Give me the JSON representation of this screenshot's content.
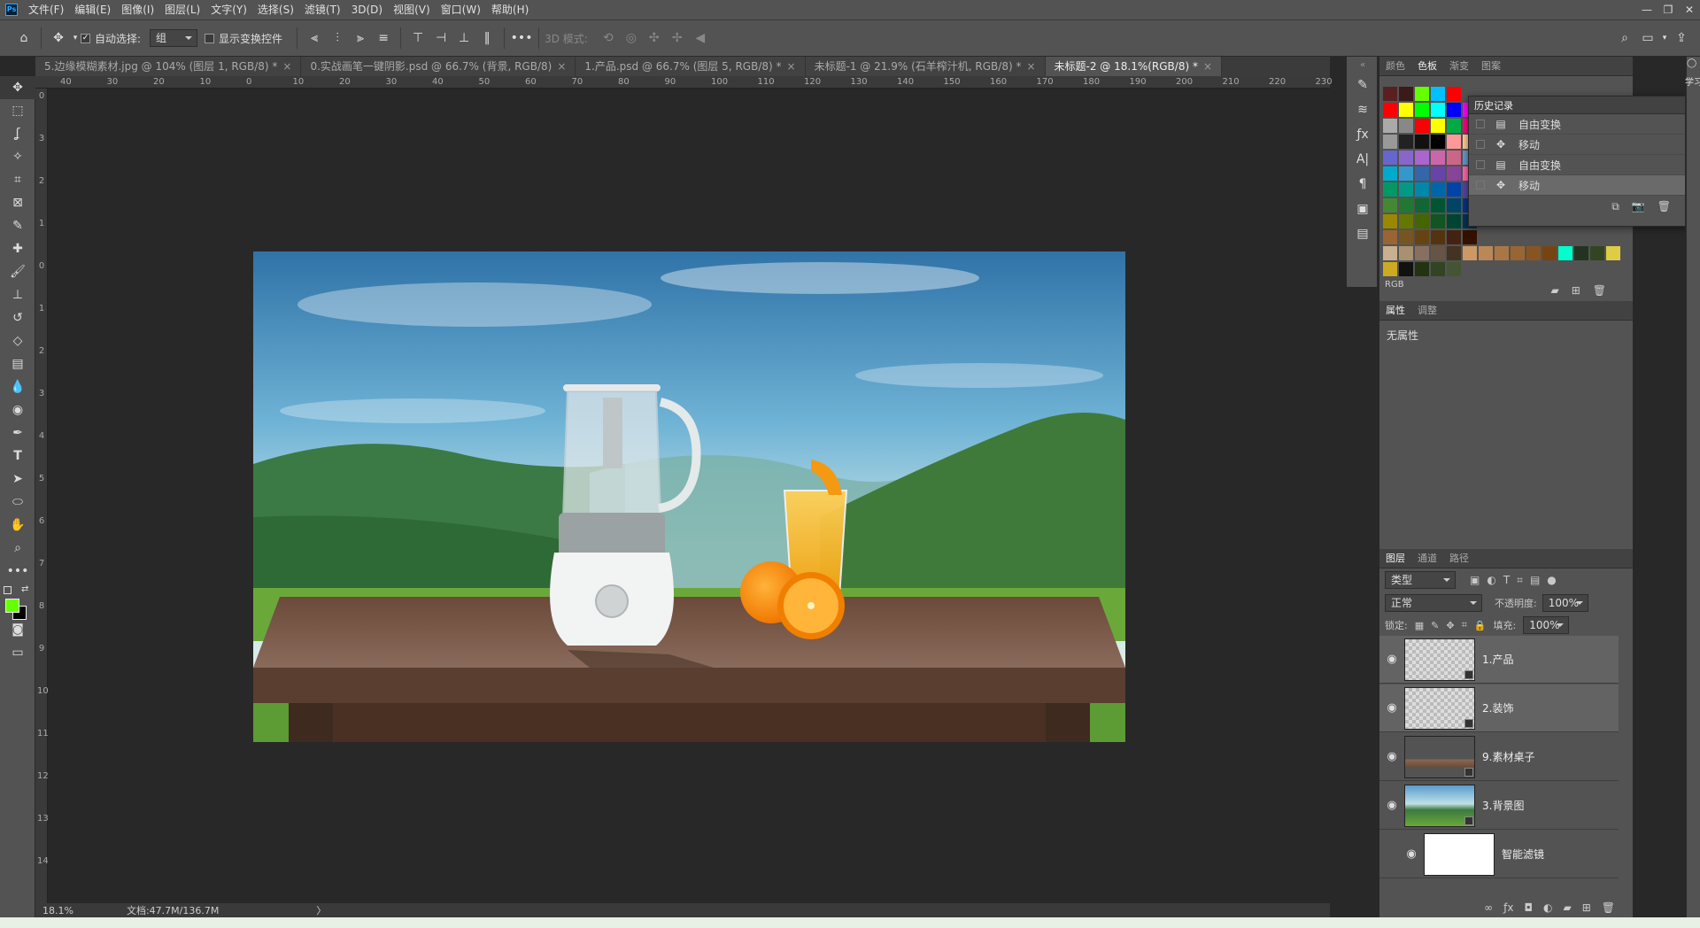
{
  "menu": [
    "文件(F)",
    "编辑(E)",
    "图像(I)",
    "图层(L)",
    "文字(Y)",
    "选择(S)",
    "滤镜(T)",
    "3D(D)",
    "视图(V)",
    "窗口(W)",
    "帮助(H)"
  ],
  "window_controls": [
    "—",
    "❐",
    "✕"
  ],
  "options": {
    "auto_select_label": "自动选择:",
    "auto_select_value": "组",
    "show_transform_label": "显示变换控件",
    "mode_3d_label": "3D 模式:"
  },
  "tabs": [
    {
      "label": "5.边缘模糊素材.jpg @ 104% (图层 1, RGB/8) *",
      "active": false
    },
    {
      "label": "0.实战画笔一键阴影.psd @ 66.7% (背景, RGB/8)",
      "active": false
    },
    {
      "label": "1.产品.psd @ 66.7% (图层 5, RGB/8) *",
      "active": false
    },
    {
      "label": "未标题-1 @ 21.9% (石羊榨汁机, RGB/8) *",
      "active": false
    },
    {
      "label": "未标题-2 @ 18.1%(RGB/8) *",
      "active": true
    }
  ],
  "ruler_top": [
    "40",
    "30",
    "20",
    "10",
    "0",
    "10",
    "20",
    "30",
    "40",
    "50",
    "60",
    "70",
    "80",
    "90",
    "100",
    "110",
    "120",
    "130",
    "140",
    "150",
    "160",
    "170",
    "180",
    "190",
    "200",
    "210",
    "220",
    "230"
  ],
  "ruler_left": [
    "0",
    "3",
    "2",
    "1",
    "0",
    "1",
    "2",
    "3",
    "4",
    "5",
    "6",
    "7",
    "8",
    "9",
    "10",
    "11",
    "12",
    "13",
    "14"
  ],
  "status": {
    "zoom": "18.1%",
    "doc": "文档:47.7M/136.7M"
  },
  "top_panel": {
    "tabs": [
      "颜色",
      "色板",
      "渐变",
      "图案"
    ],
    "active_tab": "色板",
    "group_label": "RGB"
  },
  "swatch_colors": [
    [
      "#5a1f1f",
      "#3a1a1a",
      "#66ff00",
      "#00c0ff",
      "#ff0000"
    ],
    [
      "#ff0000",
      "#ffff00",
      "#00ff00",
      "#00ffff",
      "#0000ff",
      "#ff00ff"
    ],
    [
      "#aaaaaa",
      "#888888",
      "#ff0000",
      "#ffff00",
      "#00aa44",
      "#ff0080"
    ],
    [
      "#999999",
      "#222222",
      "#111111",
      "#000000",
      "#ff9999",
      "#ffcc99"
    ],
    [
      "#6666cc",
      "#8866cc",
      "#aa66cc",
      "#cc66aa",
      "#cc6688",
      "#6699cc"
    ],
    [
      "#00aacc",
      "#3399cc",
      "#3366aa",
      "#6644aa",
      "#884499",
      "#ff66aa"
    ],
    [
      "#009966",
      "#009988",
      "#0088aa",
      "#0066aa",
      "#0044aa",
      "#5544aa"
    ],
    [
      "#448833",
      "#227733",
      "#116633",
      "#005533",
      "#004466",
      "#003388"
    ],
    [
      "#998800",
      "#667700",
      "#446600",
      "#115522",
      "#004433",
      "#003355"
    ],
    [
      "#996633",
      "#775522",
      "#664411",
      "#553311",
      "#442211",
      "#331100"
    ],
    [
      "#c8b090",
      "#a89070",
      "#887060",
      "#665544",
      "#443322",
      "#cc9966",
      "#bb8855",
      "#aa7744",
      "#996633",
      "#885522",
      "#774411",
      "#00ffcc",
      "#223322",
      "#334422",
      "#ddcc44"
    ],
    [
      "#ccaa22",
      "#111111",
      "#223311",
      "#334422",
      "#445533"
    ]
  ],
  "history": {
    "title": "历史记录",
    "items": [
      "自由变换",
      "移动",
      "自由变换",
      "移动"
    ]
  },
  "properties": {
    "tabs": [
      "属性",
      "调整"
    ],
    "text": "无属性"
  },
  "layers_panel": {
    "tabs": [
      "图层",
      "通道",
      "路径"
    ],
    "filter_kind": "类型",
    "blend_mode": "正常",
    "opacity_label": "不透明度:",
    "opacity": "100%",
    "lock_label": "锁定:",
    "fill_label": "填充:",
    "fill": "100%",
    "layers": [
      {
        "name": "1.产品",
        "selected": true
      },
      {
        "name": "2.装饰",
        "selected": true
      },
      {
        "name": "9.素材桌子",
        "selected": false
      },
      {
        "name": "3.背景图",
        "selected": false
      },
      {
        "name": "智能滤镜",
        "selected": false
      }
    ]
  },
  "learn": "学习",
  "colors": {
    "foreground": "#66ff00",
    "background": "#000000",
    "accent": "#31a8ff"
  }
}
